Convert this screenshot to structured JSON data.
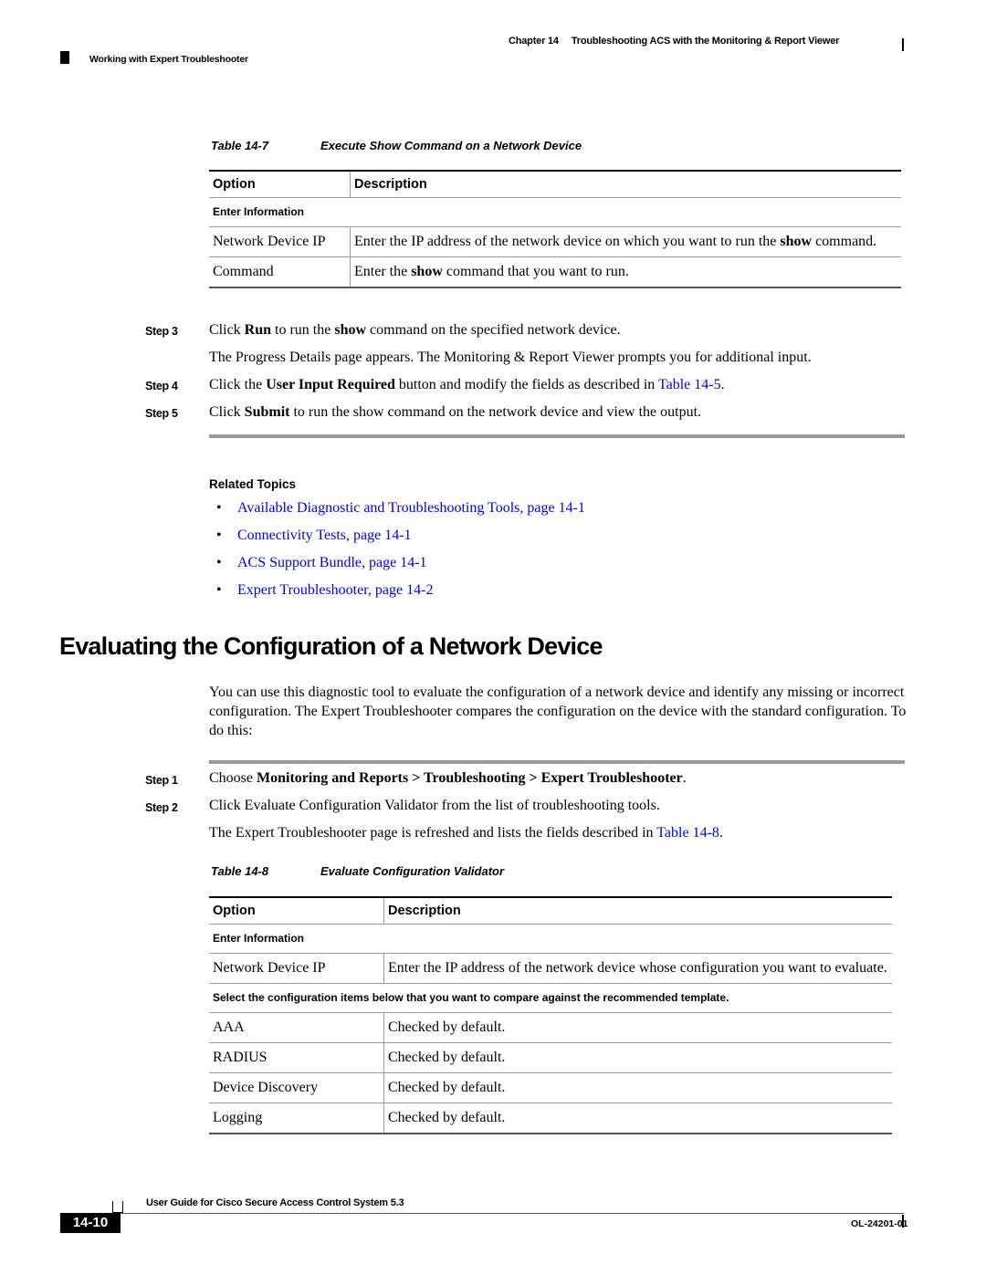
{
  "header": {
    "chapter_label": "Chapter 14",
    "chapter_title": "Troubleshooting ACS with the Monitoring & Report Viewer",
    "section": "Working with Expert Troubleshooter"
  },
  "table_14_7": {
    "caption_num": "Table 14-7",
    "caption_title": "Execute Show Command on a Network Device",
    "headers": [
      "Option",
      "Description"
    ],
    "section_row": "Enter Information",
    "rows": [
      {
        "option": "Network Device IP",
        "desc_pre": "Enter the IP address of the network device on which you want to run the ",
        "desc_bold": "show",
        "desc_post": " command."
      },
      {
        "option": "Command",
        "desc_pre": "Enter the ",
        "desc_bold": "show",
        "desc_post": " command that you want to run."
      }
    ]
  },
  "steps_a": [
    {
      "label": "Step 3",
      "pre": "Click ",
      "b1": "Run",
      "mid": " to run the ",
      "b2": "show",
      "post": " command on the specified network device."
    },
    {
      "label": "",
      "text": "The Progress Details page appears. The Monitoring & Report Viewer prompts you for additional input."
    },
    {
      "label": "Step 4",
      "pre": "Click the ",
      "b1": "User Input Required",
      "mid": " button and modify the fields as described in ",
      "link": "Table 14-5",
      "post": "."
    },
    {
      "label": "Step 5",
      "pre": "Click ",
      "b1": "Submit",
      "post": " to run the show command on the network device and view the output."
    }
  ],
  "related": {
    "heading": "Related Topics",
    "items": [
      "Available Diagnostic and Troubleshooting Tools, page 14-1",
      "Connectivity Tests, page 14-1",
      "ACS Support Bundle, page 14-1",
      "Expert Troubleshooter, page 14-2"
    ]
  },
  "section": {
    "title": "Evaluating the Configuration of a Network Device",
    "intro": "You can use this diagnostic tool to evaluate the configuration of a network device and identify any missing or incorrect configuration. The Expert Troubleshooter compares the configuration on the device with the standard configuration. To do this:"
  },
  "steps_b": [
    {
      "label": "Step 1",
      "pre": "Choose ",
      "b1": "Monitoring and Reports > Troubleshooting > Expert Troubleshooter",
      "post": "."
    },
    {
      "label": "Step 2",
      "text": "Click Evaluate Configuration Validator from the list of troubleshooting tools."
    },
    {
      "label": "",
      "pre": "The Expert Troubleshooter page is refreshed and lists the fields described in ",
      "link": "Table 14-8",
      "post": "."
    }
  ],
  "table_14_8": {
    "caption_num": "Table 14-8",
    "caption_title": "Evaluate Configuration Validator",
    "headers": [
      "Option",
      "Description"
    ],
    "section_row_1": "Enter Information",
    "ip_row": {
      "option": "Network Device IP",
      "desc": "Enter the IP address of the network device whose configuration you want to evaluate."
    },
    "section_row_2": "Select the configuration items below that you want to compare against the recommended template.",
    "rows": [
      {
        "option": "AAA",
        "desc": "Checked by default."
      },
      {
        "option": "RADIUS",
        "desc": "Checked by default."
      },
      {
        "option": "Device Discovery",
        "desc": "Checked by default."
      },
      {
        "option": "Logging",
        "desc": "Checked by default."
      }
    ]
  },
  "footer": {
    "guide_title": "User Guide for Cisco Secure Access Control System 5.3",
    "page_number": "14-10",
    "doc_id": "OL-24201-01"
  }
}
